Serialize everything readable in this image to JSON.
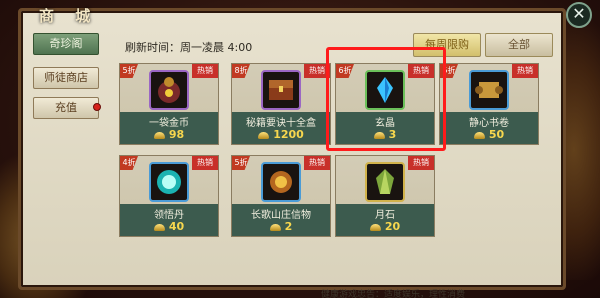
{
  "window": {
    "title": "商 城"
  },
  "nav": {
    "items": [
      {
        "label": "奇珍阁",
        "active": true
      },
      {
        "label": "师徒商店",
        "active": false
      },
      {
        "label": "充值",
        "active": false
      }
    ]
  },
  "header": {
    "refresh_time": "刷新时间：周一凌晨 4:00",
    "weekly_button": "每周限购",
    "all_button": "全部"
  },
  "items": [
    {
      "discount": "5折",
      "badge": "热销",
      "name": "一袋金币",
      "price": "98",
      "icon": "coin-bag-icon"
    },
    {
      "discount": "8折",
      "badge": "热销",
      "name": "秘籍要诀十全盒",
      "price": "1200",
      "icon": "treasure-chest-icon"
    },
    {
      "discount": "6折",
      "badge": "热销",
      "name": "玄晶",
      "price": "3",
      "icon": "blue-crystal-icon"
    },
    {
      "discount": "5折",
      "badge": "热销",
      "name": "静心书卷",
      "price": "50",
      "icon": "scroll-icon"
    },
    {
      "discount": "4折",
      "badge": "热销",
      "name": "领悟丹",
      "price": "40",
      "icon": "glowing-orb-icon"
    },
    {
      "discount": "5折",
      "badge": "热销",
      "name": "长歌山庄信物",
      "price": "2",
      "icon": "amulet-icon"
    },
    {
      "discount": "",
      "badge": "热销",
      "name": "月石",
      "price": "20",
      "icon": "moonstone-icon"
    }
  ],
  "footer": {
    "notice": "健康游戏忠告：适度娱乐，理性消费"
  },
  "colors": {
    "highlight": "#ff1b1b",
    "price": "#f7d74e",
    "hot_badge": "#c8302a"
  }
}
